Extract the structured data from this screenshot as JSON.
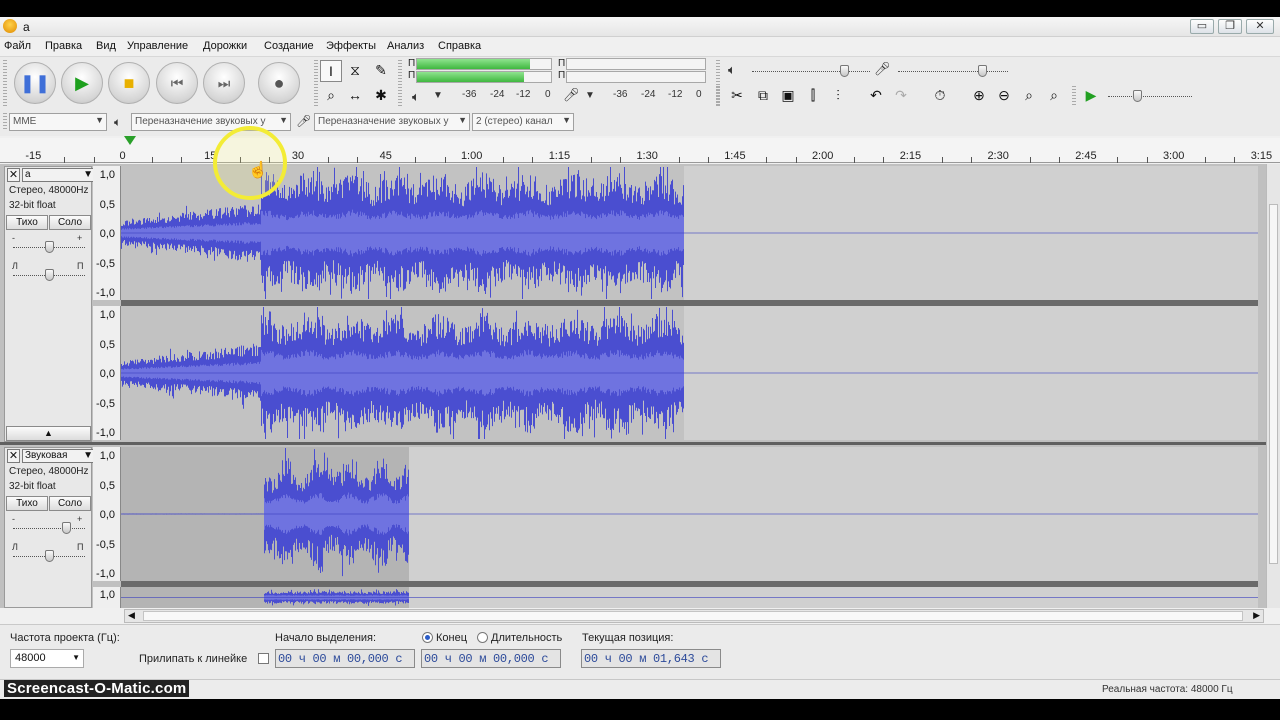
{
  "window": {
    "title": "a",
    "buttons": [
      "▭",
      "❐",
      "✕"
    ]
  },
  "menu": [
    "Файл",
    "Правка",
    "Вид",
    "Управление",
    "Дорожки",
    "Создание",
    "Эффекты",
    "Анализ",
    "Справка"
  ],
  "meters": {
    "playback_channels": [
      "П",
      "П"
    ],
    "record_scale": [
      "-36",
      "-24",
      "-12",
      "0"
    ],
    "playback_scale": [
      "-36",
      "-24",
      "-12",
      "0"
    ],
    "meter_levels": [
      0.84,
      0.8
    ],
    "output_volume": 0.78,
    "input_volume": 0.76,
    "speed": 0.35
  },
  "device_bar": {
    "host": "MME",
    "output_device": "Переназначение звуковых у",
    "input_device": "Переназначение звуковых у",
    "channels": "2 (стерео) канал"
  },
  "ruler": {
    "ticks": [
      "-15",
      "0",
      "15",
      "30",
      "45",
      "1:00",
      "1:15",
      "1:30",
      "1:45",
      "2:00",
      "2:15",
      "2:30",
      "2:45",
      "3:00",
      "3:15"
    ]
  },
  "tracks": [
    {
      "name": "a",
      "close": "✕",
      "format": "Стерео, 48000Hz",
      "bits": "32-bit float",
      "mute_label": "Тихо",
      "solo_label": "Соло",
      "gain_marks": [
        "-",
        "+"
      ],
      "pan_marks": [
        "Л",
        "П"
      ],
      "gain": 0.5,
      "pan": 0.5,
      "vruler": [
        "1,0",
        "0,5",
        "0,0",
        "-0,5",
        "-1,0"
      ]
    },
    {
      "name": "Звуковая",
      "close": "✕",
      "format": "Стерео, 48000Hz",
      "bits": "32-bit float",
      "mute_label": "Тихо",
      "solo_label": "Соло",
      "gain_marks": [
        "-",
        "+"
      ],
      "pan_marks": [
        "Л",
        "П"
      ],
      "gain": 0.73,
      "pan": 0.5,
      "vruler": [
        "1,0",
        "0,5",
        "0,0",
        "-0,5",
        "-1,0"
      ],
      "vruler_second_top": "1,0"
    }
  ],
  "selection_bar": {
    "rate_label": "Частота проекта (Гц):",
    "rate_value": "48000",
    "snap_label": "Прилипать к линейке",
    "start_label": "Начало выделения:",
    "end_label": "Конец",
    "length_label": "Длительность",
    "position_label": "Текущая позиция:",
    "start_value": "00 ч 00 м 00,000 с",
    "end_value": "00 ч 00 м 00,000 с",
    "position_value": "00 ч 00 м 01,643 с"
  },
  "status": {
    "actual_rate": "Реальная частота: 48000 Гц"
  },
  "watermark": "Screencast-O-Matic.com",
  "colors": {
    "waveform": "#4a4ed0",
    "waveform_rms": "#6f73e0",
    "meter_green": "#5ed05e",
    "highlight": "#f3ec36"
  }
}
